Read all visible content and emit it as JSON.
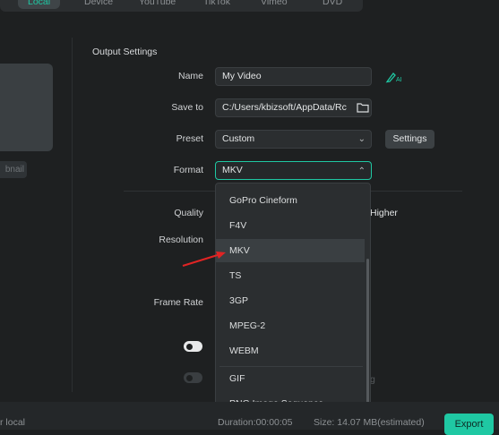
{
  "tabs": [
    "Local",
    "Device",
    "YouTube",
    "TikTok",
    "Vimeo",
    "DVD"
  ],
  "left_panel": {
    "thumb_button_label": "bnail"
  },
  "output_settings": {
    "title": "Output Settings",
    "name_label": "Name",
    "name_value": "My Video",
    "save_to_label": "Save to",
    "save_to_value": "C:/Users/kbizsoft/AppData/Rc",
    "preset_label": "Preset",
    "preset_value": "Custom",
    "settings_button": "Settings",
    "format_label": "Format",
    "format_value": "MKV",
    "quality_label": "Quality",
    "quality_value": "Higher",
    "resolution_label": "Resolution",
    "frame_rate_label": "Frame Rate",
    "obscured_text": "g"
  },
  "format_dropdown": {
    "options": [
      "GoPro Cineform",
      "F4V",
      "MKV",
      "TS",
      "3GP",
      "MPEG-2",
      "WEBM",
      "GIF",
      "PNG Image Sequence"
    ],
    "selected": "MKV"
  },
  "bottom_bar": {
    "left_text": "r local",
    "duration_text": "Duration:00:00:05",
    "size_text": "Size: 14.07 MB(estimated)",
    "export_label": "Export"
  },
  "colors": {
    "accent": "#1fc8a3",
    "annotation_arrow": "#e02424"
  },
  "icons": {
    "ai_rename": "ai-pen-icon",
    "folder": "folder-icon"
  }
}
